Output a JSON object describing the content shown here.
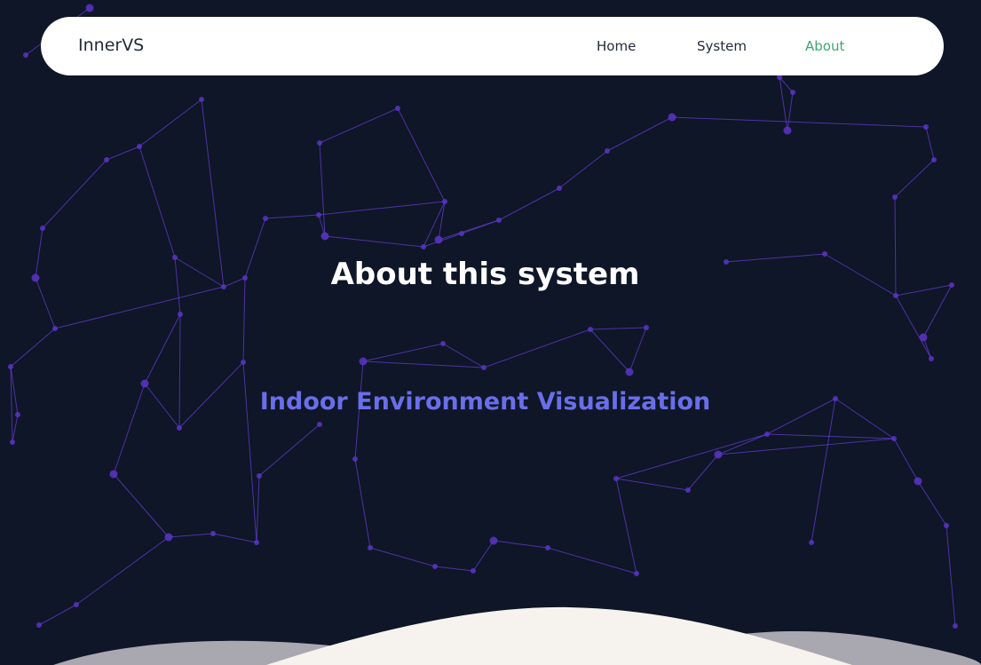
{
  "navbar": {
    "brand": "InnerVS",
    "links": [
      {
        "label": "Home",
        "active": false
      },
      {
        "label": "System",
        "active": false
      },
      {
        "label": "About",
        "active": true
      }
    ]
  },
  "hero": {
    "title": "About this system",
    "subtitle": "Indoor Environment Visualization"
  },
  "colors": {
    "background": "#0e1628",
    "network_line": "#6a3fd6",
    "network_node": "#5b34c4",
    "active_link": "#3aa772",
    "subtitle": "#6a6ee8",
    "wave_front": "#f6f3ef",
    "wave_back": "#a9a8b0"
  }
}
